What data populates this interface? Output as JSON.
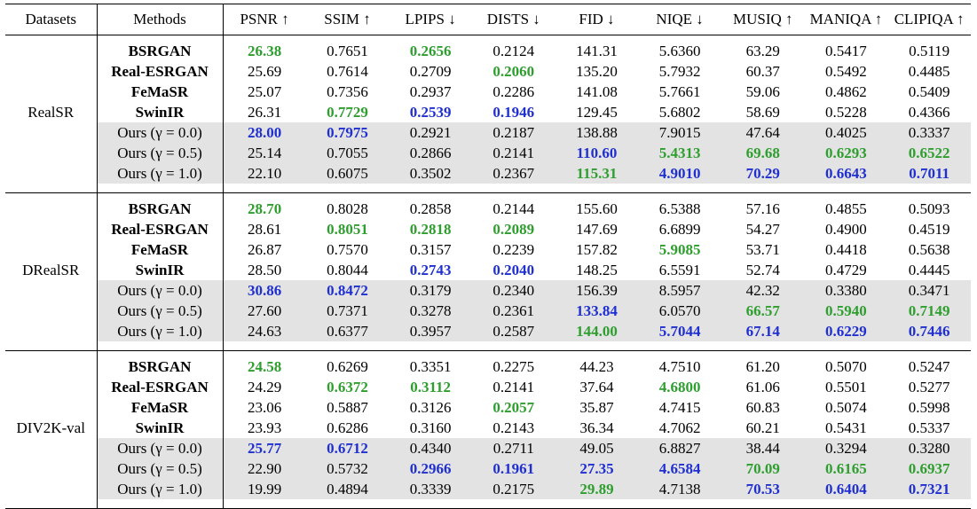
{
  "table": {
    "headers": [
      "Datasets",
      "Methods",
      "PSNR ↑",
      "SSIM ↑",
      "LPIPS ↓",
      "DISTS ↓",
      "FID ↓",
      "NIQE ↓",
      "MUSIQ ↑",
      "MANIQA ↑",
      "CLIPIQA ↑"
    ],
    "colors": {
      "best": "#2e9e2e",
      "second": "#1f2fd0",
      "shade": "#e3e3e3"
    },
    "groups": [
      {
        "dataset": "RealSR",
        "rows": [
          {
            "method": "BSRGAN",
            "values": [
              "26.38",
              "0.7651",
              "0.2656",
              "0.2124",
              "141.31",
              "5.6360",
              "63.29",
              "0.5417",
              "0.5119"
            ],
            "marks": [
              "g",
              "",
              "g",
              "",
              "",
              "",
              "",
              "",
              ""
            ]
          },
          {
            "method": "Real-ESRGAN",
            "values": [
              "25.69",
              "0.7614",
              "0.2709",
              "0.2060",
              "135.20",
              "5.7932",
              "60.37",
              "0.5492",
              "0.4485"
            ],
            "marks": [
              "",
              "",
              "",
              "g",
              "",
              "",
              "",
              "",
              ""
            ]
          },
          {
            "method": "FeMaSR",
            "values": [
              "25.07",
              "0.7356",
              "0.2937",
              "0.2286",
              "141.08",
              "5.7661",
              "59.06",
              "0.4862",
              "0.5409"
            ],
            "marks": [
              "",
              "",
              "",
              "",
              "",
              "",
              "",
              "",
              ""
            ]
          },
          {
            "method": "SwinIR",
            "values": [
              "26.31",
              "0.7729",
              "0.2539",
              "0.1946",
              "129.45",
              "5.6802",
              "58.69",
              "0.5228",
              "0.4366"
            ],
            "marks": [
              "",
              "g",
              "b",
              "b",
              "",
              "",
              "",
              "",
              ""
            ]
          },
          {
            "method": "Ours (γ = 0.0)",
            "values": [
              "28.00",
              "0.7975",
              "0.2921",
              "0.2187",
              "138.88",
              "7.9015",
              "47.64",
              "0.4025",
              "0.3337"
            ],
            "marks": [
              "b",
              "b",
              "",
              "",
              "",
              "",
              "",
              "",
              ""
            ]
          },
          {
            "method": "Ours (γ = 0.5)",
            "values": [
              "25.14",
              "0.7055",
              "0.2866",
              "0.2141",
              "110.60",
              "5.4313",
              "69.68",
              "0.6293",
              "0.6522"
            ],
            "marks": [
              "",
              "",
              "",
              "",
              "b",
              "g",
              "g",
              "g",
              "g"
            ]
          },
          {
            "method": "Ours (γ = 1.0)",
            "values": [
              "22.10",
              "0.6075",
              "0.3502",
              "0.2367",
              "115.31",
              "4.9010",
              "70.29",
              "0.6643",
              "0.7011"
            ],
            "marks": [
              "",
              "",
              "",
              "",
              "g",
              "b",
              "b",
              "b",
              "b"
            ]
          }
        ]
      },
      {
        "dataset": "DRealSR",
        "rows": [
          {
            "method": "BSRGAN",
            "values": [
              "28.70",
              "0.8028",
              "0.2858",
              "0.2144",
              "155.60",
              "6.5388",
              "57.16",
              "0.4855",
              "0.5093"
            ],
            "marks": [
              "g",
              "",
              "",
              "",
              "",
              "",
              "",
              "",
              ""
            ]
          },
          {
            "method": "Real-ESRGAN",
            "values": [
              "28.61",
              "0.8051",
              "0.2818",
              "0.2089",
              "147.69",
              "6.6899",
              "54.27",
              "0.4900",
              "0.4519"
            ],
            "marks": [
              "",
              "g",
              "g",
              "g",
              "",
              "",
              "",
              "",
              ""
            ]
          },
          {
            "method": "FeMaSR",
            "values": [
              "26.87",
              "0.7570",
              "0.3157",
              "0.2239",
              "157.82",
              "5.9085",
              "53.71",
              "0.4418",
              "0.5638"
            ],
            "marks": [
              "",
              "",
              "",
              "",
              "",
              "g",
              "",
              "",
              ""
            ]
          },
          {
            "method": "SwinIR",
            "values": [
              "28.50",
              "0.8044",
              "0.2743",
              "0.2040",
              "148.25",
              "6.5591",
              "52.74",
              "0.4729",
              "0.4445"
            ],
            "marks": [
              "",
              "",
              "b",
              "b",
              "",
              "",
              "",
              "",
              ""
            ]
          },
          {
            "method": "Ours (γ = 0.0)",
            "values": [
              "30.86",
              "0.8472",
              "0.3179",
              "0.2340",
              "156.39",
              "8.5957",
              "42.32",
              "0.3380",
              "0.3471"
            ],
            "marks": [
              "b",
              "b",
              "",
              "",
              "",
              "",
              "",
              "",
              ""
            ]
          },
          {
            "method": "Ours (γ = 0.5)",
            "values": [
              "27.60",
              "0.7371",
              "0.3278",
              "0.2361",
              "133.84",
              "6.0570",
              "66.57",
              "0.5940",
              "0.7149"
            ],
            "marks": [
              "",
              "",
              "",
              "",
              "b",
              "",
              "g",
              "g",
              "g"
            ]
          },
          {
            "method": "Ours (γ = 1.0)",
            "values": [
              "24.63",
              "0.6377",
              "0.3957",
              "0.2587",
              "144.00",
              "5.7044",
              "67.14",
              "0.6229",
              "0.7446"
            ],
            "marks": [
              "",
              "",
              "",
              "",
              "g",
              "b",
              "b",
              "b",
              "b"
            ]
          }
        ]
      },
      {
        "dataset": "DIV2K-val",
        "rows": [
          {
            "method": "BSRGAN",
            "values": [
              "24.58",
              "0.6269",
              "0.3351",
              "0.2275",
              "44.23",
              "4.7510",
              "61.20",
              "0.5070",
              "0.5247"
            ],
            "marks": [
              "g",
              "",
              "",
              "",
              "",
              "",
              "",
              "",
              ""
            ]
          },
          {
            "method": "Real-ESRGAN",
            "values": [
              "24.29",
              "0.6372",
              "0.3112",
              "0.2141",
              "37.64",
              "4.6800",
              "61.06",
              "0.5501",
              "0.5277"
            ],
            "marks": [
              "",
              "g",
              "g",
              "",
              "",
              "g",
              "",
              "",
              ""
            ]
          },
          {
            "method": "FeMaSR",
            "values": [
              "23.06",
              "0.5887",
              "0.3126",
              "0.2057",
              "35.87",
              "4.7415",
              "60.83",
              "0.5074",
              "0.5998"
            ],
            "marks": [
              "",
              "",
              "",
              "g",
              "",
              "",
              "",
              "",
              ""
            ]
          },
          {
            "method": "SwinIR",
            "values": [
              "23.93",
              "0.6286",
              "0.3160",
              "0.2143",
              "36.34",
              "4.7062",
              "60.21",
              "0.5431",
              "0.5337"
            ],
            "marks": [
              "",
              "",
              "",
              "",
              "",
              "",
              "",
              "",
              ""
            ]
          },
          {
            "method": "Ours (γ = 0.0)",
            "values": [
              "25.77",
              "0.6712",
              "0.4340",
              "0.2711",
              "49.05",
              "6.8827",
              "38.44",
              "0.3294",
              "0.3280"
            ],
            "marks": [
              "b",
              "b",
              "",
              "",
              "",
              "",
              "",
              "",
              ""
            ]
          },
          {
            "method": "Ours (γ = 0.5)",
            "values": [
              "22.90",
              "0.5732",
              "0.2966",
              "0.1961",
              "27.35",
              "4.6584",
              "70.09",
              "0.6165",
              "0.6937"
            ],
            "marks": [
              "",
              "",
              "b",
              "b",
              "b",
              "b",
              "g",
              "g",
              "g"
            ]
          },
          {
            "method": "Ours (γ = 1.0)",
            "values": [
              "19.99",
              "0.4894",
              "0.3339",
              "0.2175",
              "29.89",
              "4.7138",
              "70.53",
              "0.6404",
              "0.7321"
            ],
            "marks": [
              "",
              "",
              "",
              "",
              "g",
              "",
              "b",
              "b",
              "b"
            ]
          }
        ]
      }
    ]
  }
}
